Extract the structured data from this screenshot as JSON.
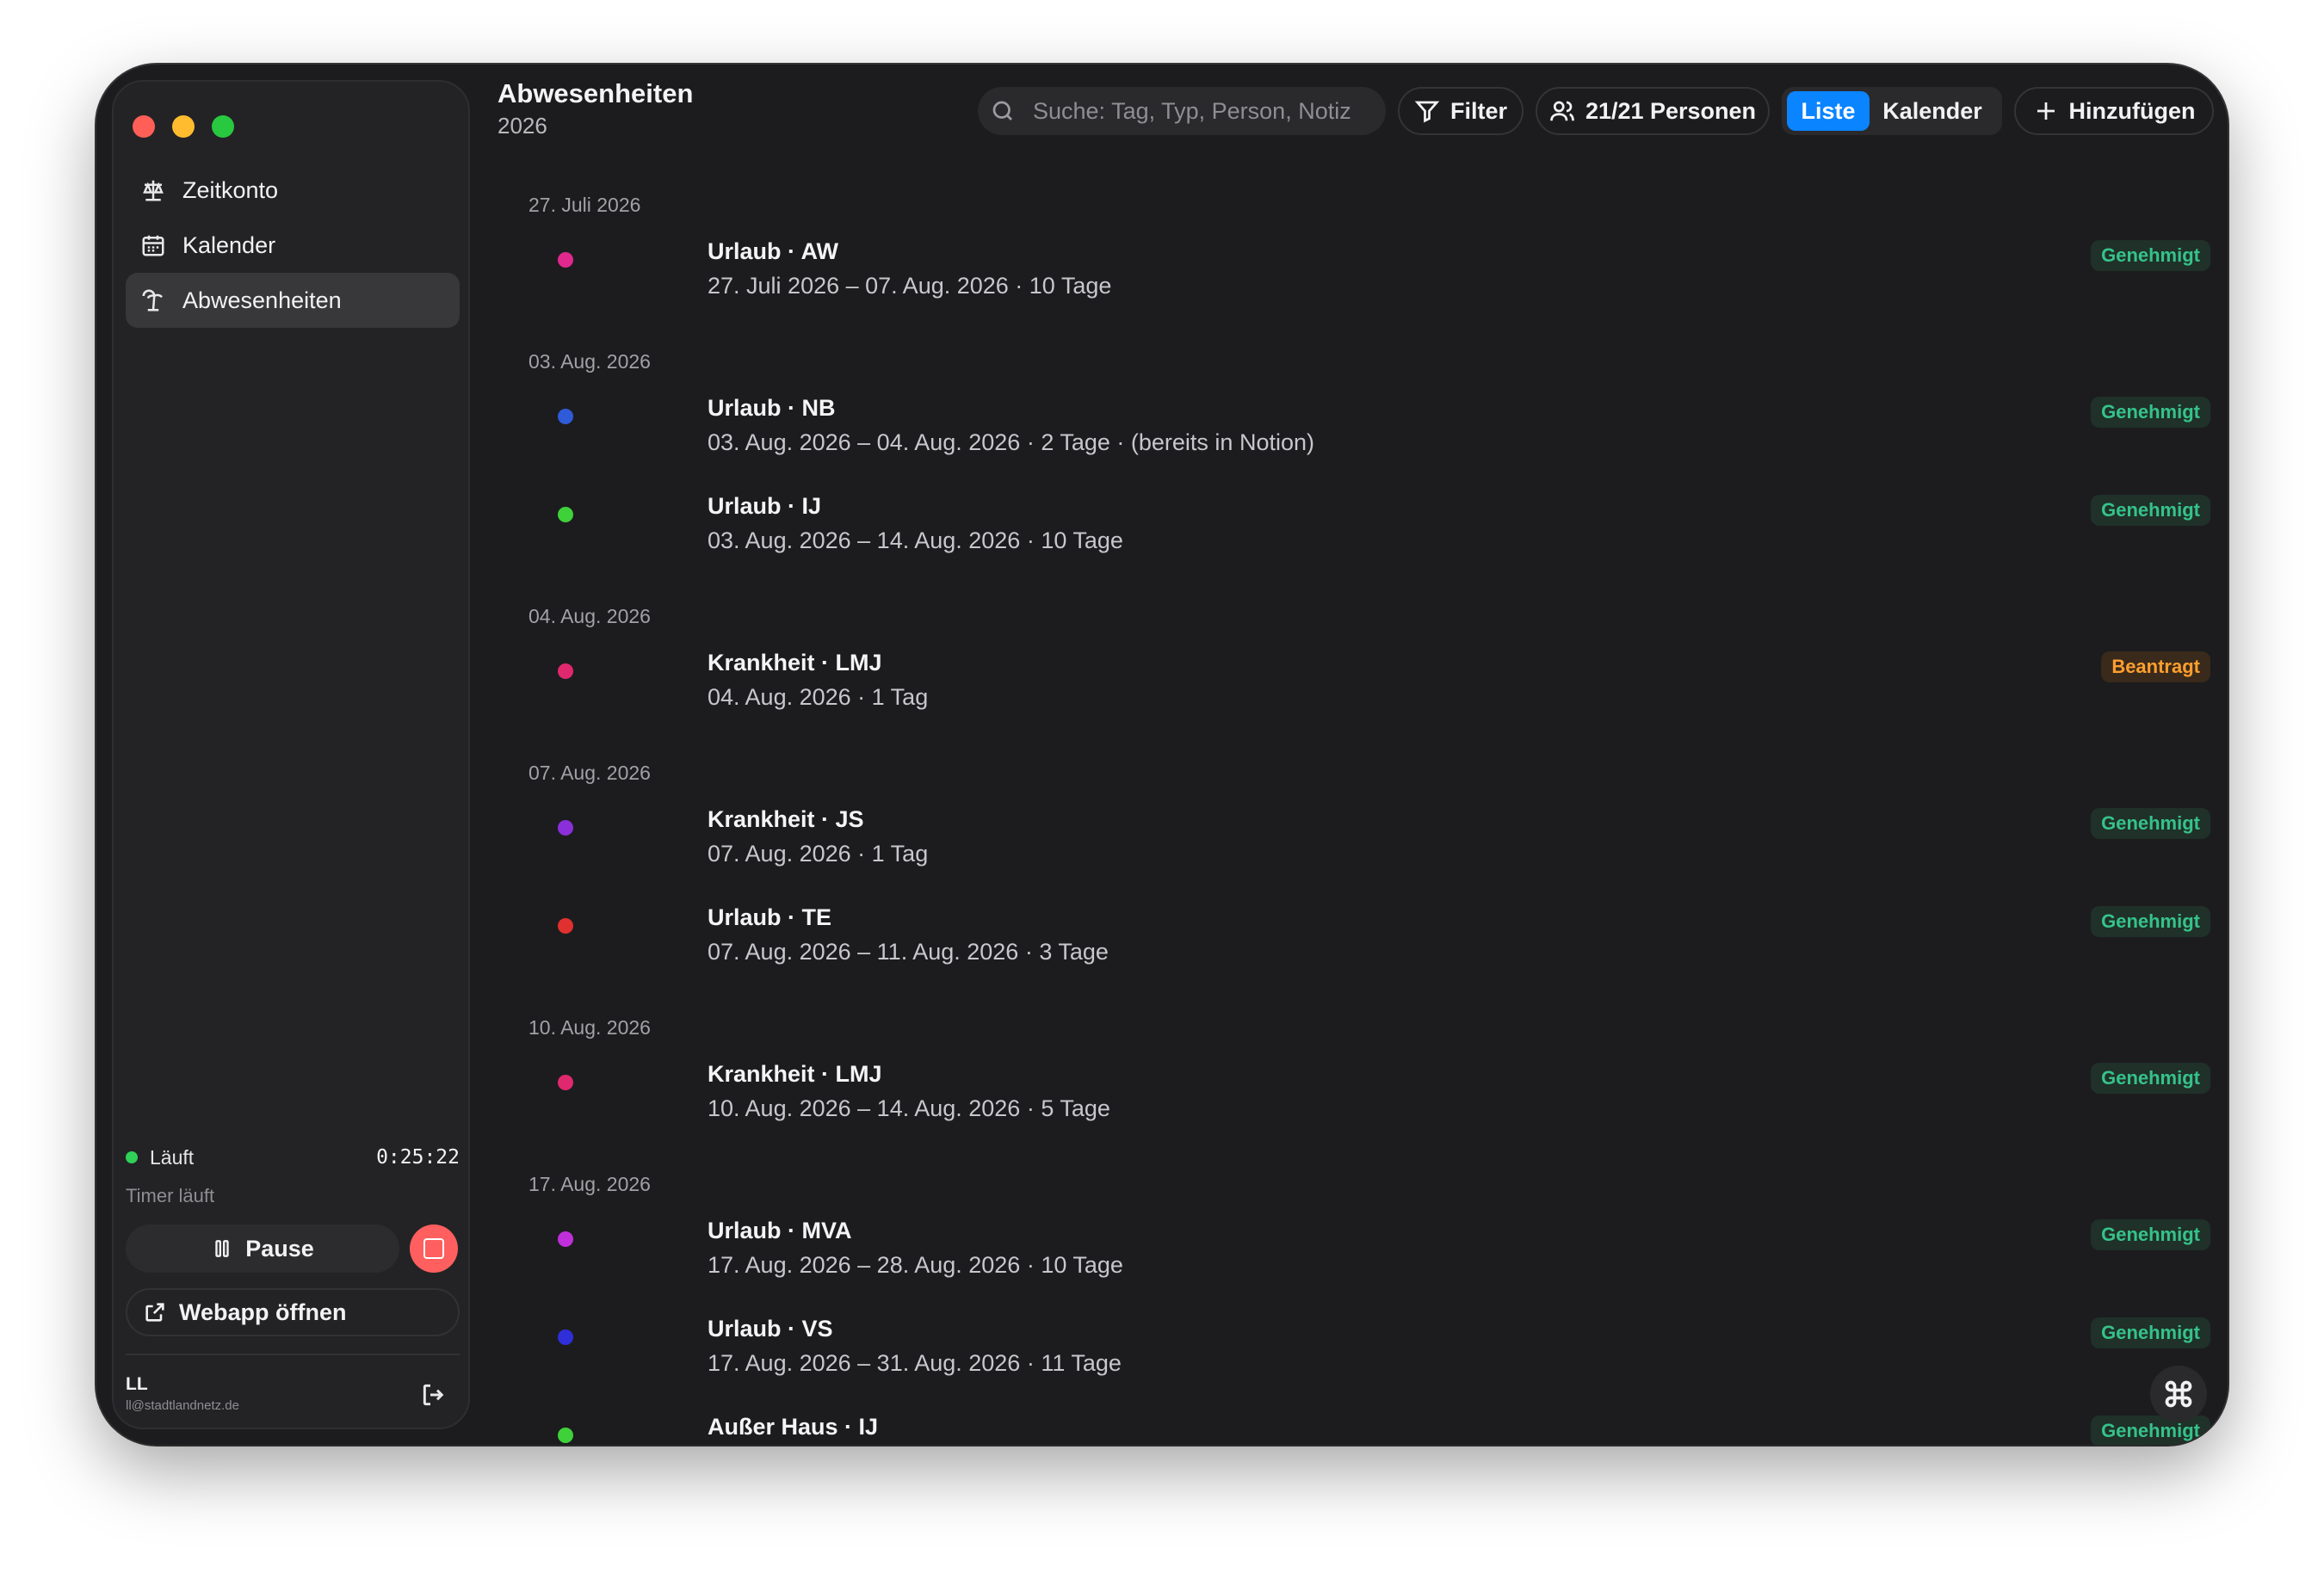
{
  "sidebar": {
    "nav": [
      {
        "label": "Zeitkonto",
        "icon": "scale-icon"
      },
      {
        "label": "Kalender",
        "icon": "calendar-icon"
      },
      {
        "label": "Abwesenheiten",
        "icon": "palm-tree-icon",
        "active": true
      }
    ],
    "timer": {
      "status": "Läuft",
      "time": "0:25:22",
      "subtitle": "Timer läuft",
      "pause_label": "Pause"
    },
    "webapp_label": "Webapp öffnen",
    "user": {
      "initials": "LL",
      "email": "ll@stadtlandnetz.de"
    }
  },
  "header": {
    "title": "Abwesenheiten",
    "subtitle": "2026",
    "search_placeholder": "Suche: Tag, Typ, Person, Notiz",
    "filter_label": "Filter",
    "persons_label": "21/21 Personen",
    "view_toggle": {
      "list": "Liste",
      "calendar": "Kalender",
      "selected": "Liste"
    },
    "add_label": "Hinzufügen"
  },
  "colors": {
    "accent": "#0a84ff",
    "approved": "#36c28a",
    "pending": "#ff9f2e",
    "running": "#30d158",
    "stop": "#ff5f5f"
  },
  "absences": [
    {
      "date": "27. Juli 2026",
      "entries": [
        {
          "title": "Urlaub · AW",
          "detail": "27. Juli 2026 – 07. Aug. 2026 · 10 Tage",
          "status": "Genehmigt",
          "color": "#e0288f"
        }
      ]
    },
    {
      "date": "03. Aug. 2026",
      "entries": [
        {
          "title": "Urlaub · NB",
          "detail": "03. Aug. 2026 – 04. Aug. 2026 · 2 Tage · (bereits in Notion)",
          "status": "Genehmigt",
          "color": "#2f5bd9"
        },
        {
          "title": "Urlaub · IJ",
          "detail": "03. Aug. 2026 – 14. Aug. 2026 · 10 Tage",
          "status": "Genehmigt",
          "color": "#3fd13a"
        }
      ]
    },
    {
      "date": "04. Aug. 2026",
      "entries": [
        {
          "title": "Krankheit · LMJ",
          "detail": "04. Aug. 2026 · 1 Tag",
          "status": "Beantragt",
          "color": "#e0286f"
        }
      ]
    },
    {
      "date": "07. Aug. 2026",
      "entries": [
        {
          "title": "Krankheit · JS",
          "detail": "07. Aug. 2026 · 1 Tag",
          "status": "Genehmigt",
          "color": "#8a2fd9"
        },
        {
          "title": "Urlaub · TE",
          "detail": "07. Aug. 2026 – 11. Aug. 2026 · 3 Tage",
          "status": "Genehmigt",
          "color": "#e0302f"
        }
      ]
    },
    {
      "date": "10. Aug. 2026",
      "entries": [
        {
          "title": "Krankheit · LMJ",
          "detail": "10. Aug. 2026 – 14. Aug. 2026 · 5 Tage",
          "status": "Genehmigt",
          "color": "#e0286f"
        }
      ]
    },
    {
      "date": "17. Aug. 2026",
      "entries": [
        {
          "title": "Urlaub · MVA",
          "detail": "17. Aug. 2026 – 28. Aug. 2026 · 10 Tage",
          "status": "Genehmigt",
          "color": "#c02fd9"
        },
        {
          "title": "Urlaub · VS",
          "detail": "17. Aug. 2026 – 31. Aug. 2026 · 11 Tage",
          "status": "Genehmigt",
          "color": "#2f2fd9"
        },
        {
          "title": "Außer Haus · IJ",
          "detail": "",
          "status": "Genehmigt",
          "color": "#3fd13a"
        }
      ]
    }
  ]
}
